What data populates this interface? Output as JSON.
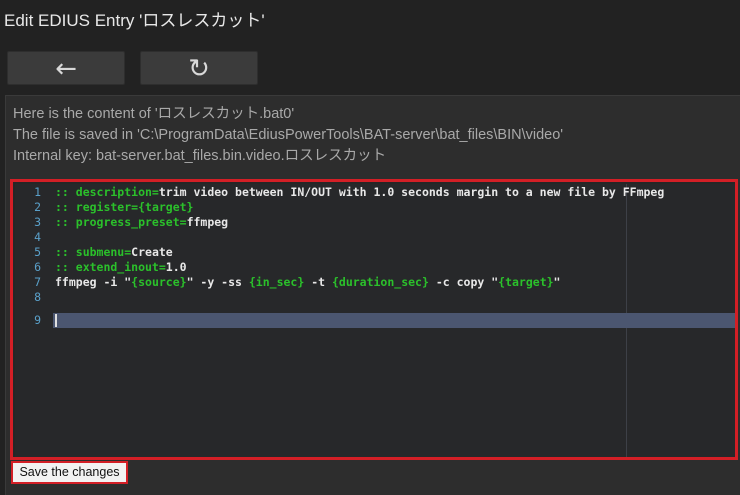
{
  "page": {
    "title": "Edit EDIUS Entry 'ロスレスカット'"
  },
  "nav": {
    "back_label": "←",
    "reload_label": "↻"
  },
  "info": {
    "line1": "Here is the content of 'ロスレスカット.bat0'",
    "line2": "The file is saved in 'C:\\ProgramData\\EdiusPowerTools\\BAT-server\\bat_files\\BIN\\video'",
    "line3": "Internal key: bat-server.bat_files.bin.video.ロスレスカット"
  },
  "editor": {
    "active_line": 9,
    "lines": [
      {
        "num": "1",
        "parts": [
          {
            "t": ":: description=",
            "c": "kw"
          },
          {
            "t": "trim video between IN/OUT with 1.0 seconds margin to a new file by FFmpeg",
            "c": "plain"
          }
        ]
      },
      {
        "num": "2",
        "parts": [
          {
            "t": ":: register=",
            "c": "kw"
          },
          {
            "t": "{target}",
            "c": "var"
          }
        ]
      },
      {
        "num": "3",
        "parts": [
          {
            "t": ":: progress_preset=",
            "c": "kw"
          },
          {
            "t": "ffmpeg",
            "c": "plain"
          }
        ]
      },
      {
        "num": "4",
        "parts": []
      },
      {
        "num": "5",
        "parts": [
          {
            "t": ":: submenu=",
            "c": "kw"
          },
          {
            "t": "Create",
            "c": "plain"
          }
        ]
      },
      {
        "num": "6",
        "parts": [
          {
            "t": ":: extend_inout=",
            "c": "kw"
          },
          {
            "t": "1.0",
            "c": "plain"
          }
        ]
      },
      {
        "num": "7",
        "parts": [
          {
            "t": "ffmpeg -i \"",
            "c": "plain"
          },
          {
            "t": "{source}",
            "c": "var"
          },
          {
            "t": "\" -y -ss ",
            "c": "plain"
          },
          {
            "t": "{in_sec}",
            "c": "var"
          },
          {
            "t": " -t ",
            "c": "plain"
          },
          {
            "t": "{duration_sec}",
            "c": "var"
          },
          {
            "t": " -c copy \"",
            "c": "plain"
          },
          {
            "t": "{target}",
            "c": "var"
          },
          {
            "t": "\"",
            "c": "plain"
          }
        ]
      },
      {
        "num": "8",
        "parts": []
      },
      {
        "num": "9",
        "parts": []
      }
    ]
  },
  "actions": {
    "save_label": "Save the changes"
  }
}
